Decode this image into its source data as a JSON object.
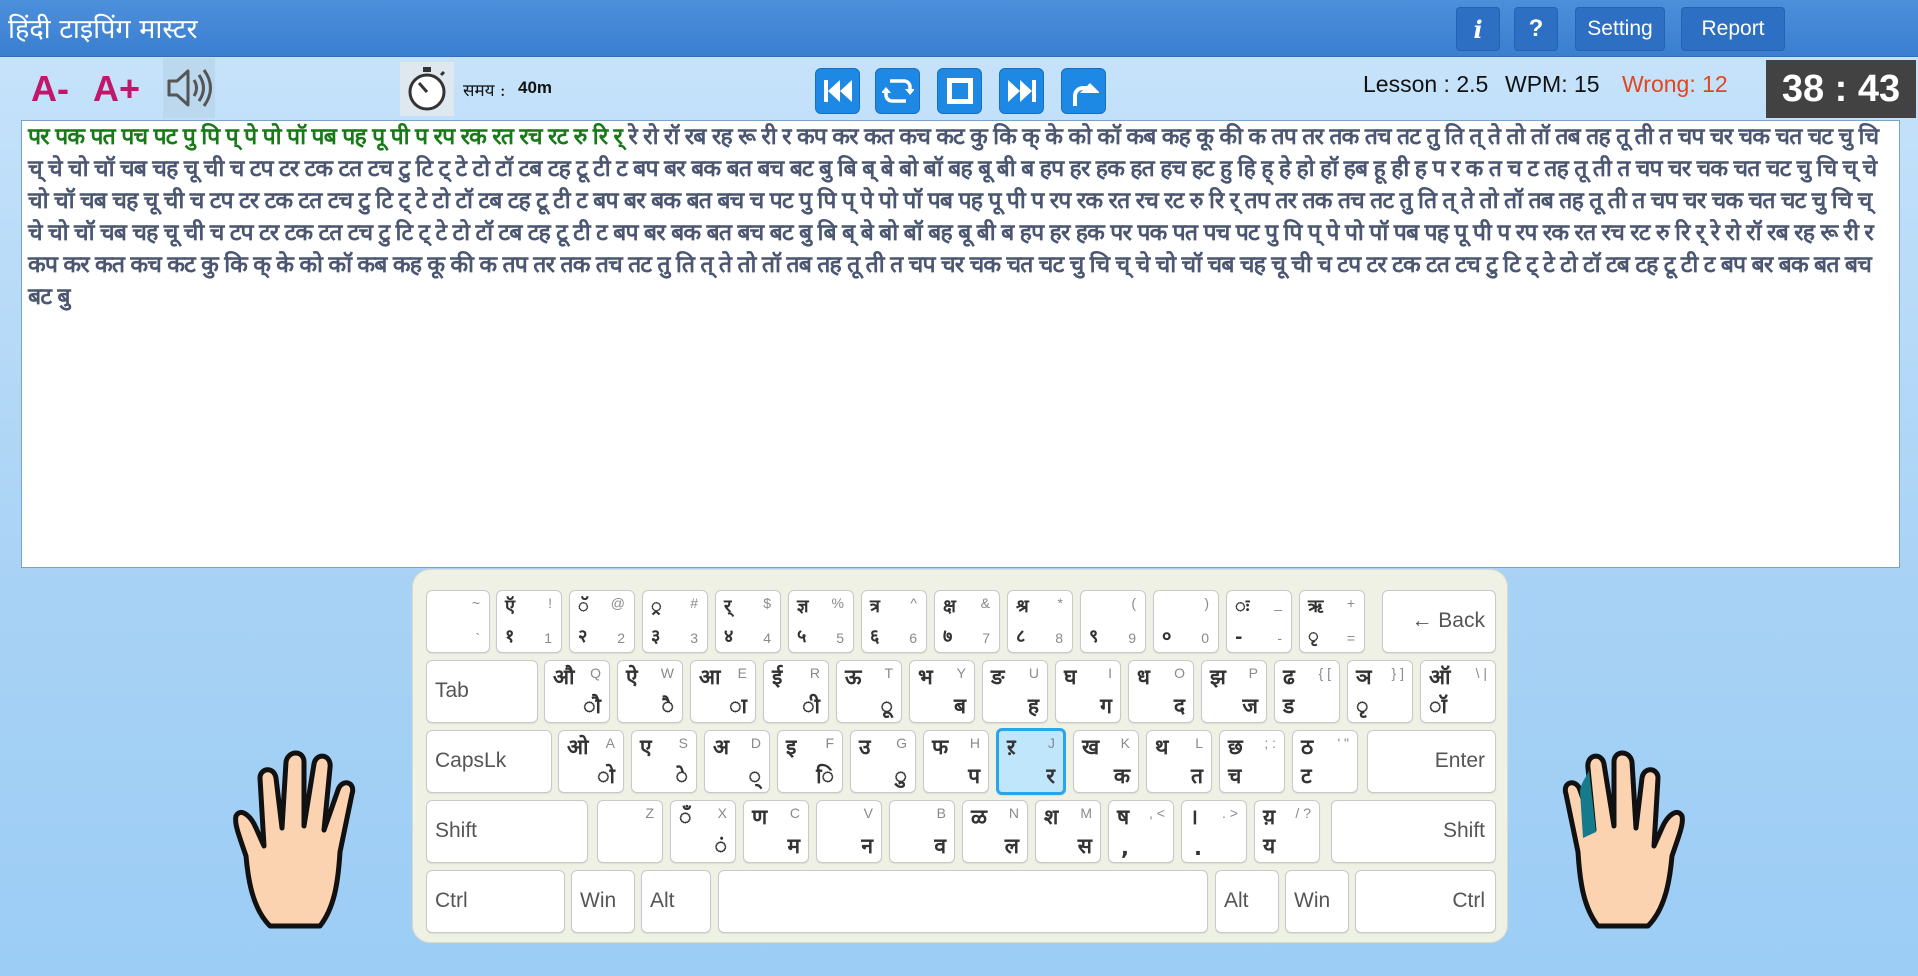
{
  "app": {
    "title": "हिंदी टाइपिंग मास्टर"
  },
  "titlebar": {
    "info_label": "i",
    "help_label": "?",
    "setting_label": "Setting",
    "report_label": "Report"
  },
  "toolbar": {
    "font_decrease": "A-",
    "font_increase": "A+",
    "time_label": "समय :",
    "time_value": "40m",
    "lesson": "Lesson : 2.5",
    "wpm": "WPM: 15",
    "wrong": "Wrong: 12",
    "clock": "38 : 43"
  },
  "colors": {
    "titlebar": "#3a7fd0",
    "typed": "#177a17",
    "pending": "#4a5672",
    "wrong": "#e0461f",
    "highlight_key": "#bfe6fb"
  },
  "text": {
    "typed": "पर पक पत पच पट पु पि प् पे पो पॉ पब पह पू पी प रप रक रत रच रट रु रि र्",
    "remaining": " रे रो रॉ रब रह रू री र कप कर कत कच कट कु कि क् के को कॉ कब कह कू की क तप तर तक तच तट तु ति त् ते तो तॉ तब तह तू ती त चप चर चक चत चट चु चि च् चे चो चॉ चब चह चू ची च टप टर टक टत टच टु टि ट् टे टो टॉ टब टह टू टी ट बप बर बक बत बच बट बु बि ब् बे बो बॉ बह बू बी ब हप हर हक हत हच हट हु हि ह् हे हो हॉ हब हू ही ह प र क त च ट तह तू ती त चप चर चक चत चट चु चि च् चे चो चॉ चब चह चू ची च टप टर टक टत टच टु टि ट् टे टो टॉ टब टह टू टी ट बप बर बक बत बच च पट पु पि प् पे पो पॉ पब पह पू पी प रप रक रत रच रट रु रि र् तप तर तक तच तट तु ति त् ते तो तॉ तब तह तू ती त चप चर चक चत चट चु चि च् चे चो चॉ चब चह चू ची च टप टर टक टत टच टु टि ट् टे टो टॉ टब टह टू टी ट बप बर बक बत बच बट बु बि ब् बे बो बॉ बह बू बी ब हप हर हक पर पक पत पच पट पु पि प् पे पो पॉ पब पह पू पी प रप रक रत रच रट रु रि र् रे रो रॉ रब रह रू री र कप कर कत कच कट कु कि क् के को कॉ कब कह कू की क तप तर तक तच तट तु ति त् ते तो तॉ तब तह तू ती त चप चर चक चत चट चु चि च् चे चो चॉ चब चह चू ची च टप टर टक टत टच टु टि ट् टे टो टॉ टब टह टू टी ट बप बर बक बत बच बट बु"
  },
  "keyboard": {
    "row1": [
      {
        "q_top": "~",
        "q_bot": "`",
        "h_top": "",
        "h_bot": ""
      },
      {
        "q_top": "!",
        "q_bot": "1",
        "h_top": "ऍ",
        "h_bot": "१"
      },
      {
        "q_top": "@",
        "q_bot": "2",
        "h_top": "ॅ",
        "h_bot": "२"
      },
      {
        "q_top": "#",
        "q_bot": "3",
        "h_top": "्र",
        "h_bot": "३"
      },
      {
        "q_top": "$",
        "q_bot": "4",
        "h_top": "र्",
        "h_bot": "४"
      },
      {
        "q_top": "%",
        "q_bot": "5",
        "h_top": "ज्ञ",
        "h_bot": "५"
      },
      {
        "q_top": "^",
        "q_bot": "6",
        "h_top": "त्र",
        "h_bot": "६"
      },
      {
        "q_top": "&",
        "q_bot": "7",
        "h_top": "क्ष",
        "h_bot": "७"
      },
      {
        "q_top": "*",
        "q_bot": "8",
        "h_top": "श्र",
        "h_bot": "८"
      },
      {
        "q_top": "(",
        "q_bot": "9",
        "h_top": "",
        "h_bot": "९"
      },
      {
        "q_top": ")",
        "q_bot": "0",
        "h_top": "",
        "h_bot": "०"
      },
      {
        "q_top": "_",
        "q_bot": "-",
        "h_top": "ः",
        "h_bot": "-"
      },
      {
        "q_top": "+",
        "q_bot": "=",
        "h_top": "ऋ",
        "h_bot": "ृ"
      }
    ],
    "back_label": "← Back",
    "tab_label": "Tab",
    "row2": [
      {
        "q": "Q",
        "h_top": "औ",
        "h_bot": "ौ"
      },
      {
        "q": "W",
        "h_top": "ऐ",
        "h_bot": "ै"
      },
      {
        "q": "E",
        "h_top": "आ",
        "h_bot": "ा"
      },
      {
        "q": "R",
        "h_top": "ई",
        "h_bot": "ी"
      },
      {
        "q": "T",
        "h_top": "ऊ",
        "h_bot": "ू"
      },
      {
        "q": "Y",
        "h_top": "भ",
        "h_bot": "ब"
      },
      {
        "q": "U",
        "h_top": "ङ",
        "h_bot": "ह"
      },
      {
        "q": "I",
        "h_top": "घ",
        "h_bot": "ग"
      },
      {
        "q": "O",
        "h_top": "ध",
        "h_bot": "द"
      },
      {
        "q": "P",
        "h_top": "झ",
        "h_bot": "ज"
      },
      {
        "q": "{ [",
        "h_top": "ढ",
        "h_bot": "ड"
      },
      {
        "q": "} ]",
        "h_top": "ञ",
        "h_bot": "ृ"
      },
      {
        "q": "\\ |",
        "h_top": "ऑ",
        "h_bot": "ॉ"
      }
    ],
    "caps_label": "CapsLk",
    "row3": [
      {
        "q": "A",
        "h_top": "ओ",
        "h_bot": "ो"
      },
      {
        "q": "S",
        "h_top": "ए",
        "h_bot": "े"
      },
      {
        "q": "D",
        "h_top": "अ",
        "h_bot": "्"
      },
      {
        "q": "F",
        "h_top": "इ",
        "h_bot": "ि"
      },
      {
        "q": "G",
        "h_top": "उ",
        "h_bot": "ु"
      },
      {
        "q": "H",
        "h_top": "फ",
        "h_bot": "प"
      },
      {
        "q": "J",
        "h_top": "ऱ",
        "h_bot": "र"
      },
      {
        "q": "K",
        "h_top": "ख",
        "h_bot": "क"
      },
      {
        "q": "L",
        "h_top": "थ",
        "h_bot": "त"
      },
      {
        "q": "; :",
        "h_top": "छ",
        "h_bot": "च"
      },
      {
        "q": "' \"",
        "h_top": "ठ",
        "h_bot": "ट"
      }
    ],
    "enter_label": "Enter",
    "shift_label": "Shift",
    "row4": [
      {
        "q": "Z",
        "h_top": "",
        "h_bot": ""
      },
      {
        "q": "X",
        "h_top": "ँ",
        "h_bot": "ं"
      },
      {
        "q": "C",
        "h_top": "ण",
        "h_bot": "म"
      },
      {
        "q": "V",
        "h_top": "",
        "h_bot": "न"
      },
      {
        "q": "B",
        "h_top": "",
        "h_bot": "व"
      },
      {
        "q": "N",
        "h_top": "ळ",
        "h_bot": "ल"
      },
      {
        "q": "M",
        "h_top": "श",
        "h_bot": "स"
      },
      {
        "q": ", <",
        "h_top": "ष",
        "h_bot": ","
      },
      {
        "q": ". >",
        "h_top": "।",
        "h_bot": "."
      },
      {
        "q": "/ ?",
        "h_top": "य़",
        "h_bot": "य"
      }
    ],
    "ctrl_label": "Ctrl",
    "win_label": "Win",
    "alt_label": "Alt"
  }
}
